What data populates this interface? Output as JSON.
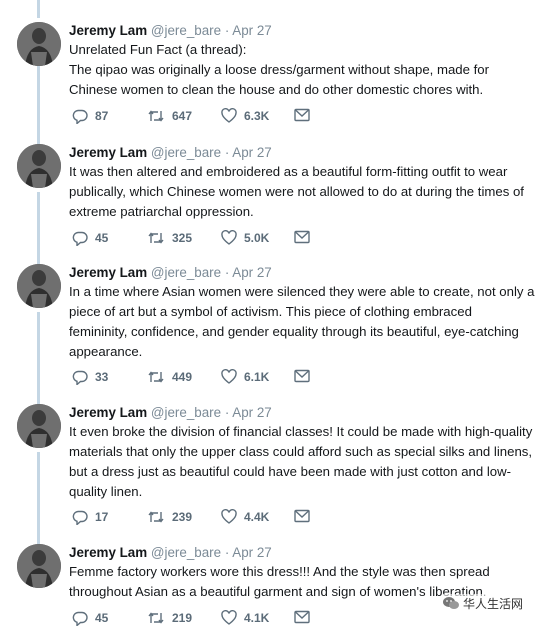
{
  "tweets": [
    {
      "name": "Jeremy Lam",
      "handle": "@jere_bare",
      "separator": "·",
      "date": "Apr 27",
      "lines": [
        "Unrelated Fun Fact (a thread):",
        "The qipao was originally a loose dress/garment without shape, made for",
        "Chinese women to clean the house and do other domestic chores with."
      ],
      "replies": "87",
      "retweets": "647",
      "likes": "6.3K"
    },
    {
      "name": "Jeremy Lam",
      "handle": "@jere_bare",
      "separator": "·",
      "date": "Apr 27",
      "lines": [
        "It was then altered and embroidered as a beautiful form-fitting outfit to wear",
        "publically, which Chinese women were not allowed to do at during the times of",
        "extreme patriarchal oppression."
      ],
      "replies": "45",
      "retweets": "325",
      "likes": "5.0K"
    },
    {
      "name": "Jeremy Lam",
      "handle": "@jere_bare",
      "separator": "·",
      "date": "Apr 27",
      "lines": [
        "In a time where Asian women were silenced they were able to create, not only a",
        "piece of art but a symbol of activism. This piece of clothing embraced",
        "femininity, confidence, and gender equality through its beautiful, eye-catching",
        "appearance."
      ],
      "replies": "33",
      "retweets": "449",
      "likes": "6.1K"
    },
    {
      "name": "Jeremy Lam",
      "handle": "@jere_bare",
      "separator": "·",
      "date": "Apr 27",
      "lines": [
        "It even broke the division of financial classes! It could be made with high-quality",
        "materials that only the upper class could afford such as special silks and linens,",
        "but a dress just as beautiful could have been made with just cotton and low-",
        "quality linen."
      ],
      "replies": "17",
      "retweets": "239",
      "likes": "4.4K"
    },
    {
      "name": "Jeremy Lam",
      "handle": "@jere_bare",
      "separator": "·",
      "date": "Apr 27",
      "lines": [
        "Femme factory workers wore this dress!!! And the style was then spread",
        "throughout Asian as a beautiful garment and sign of women's liberation."
      ],
      "replies": "45",
      "retweets": "219",
      "likes": "4.1K"
    }
  ],
  "watermark": {
    "text": "华人生活网"
  },
  "colors": {
    "thread_line": "#c4d6e4",
    "meta": "#7b8a96",
    "icon": "#5f6f7c"
  },
  "icons": [
    "reply-icon",
    "retweet-icon",
    "like-icon",
    "message-icon"
  ]
}
